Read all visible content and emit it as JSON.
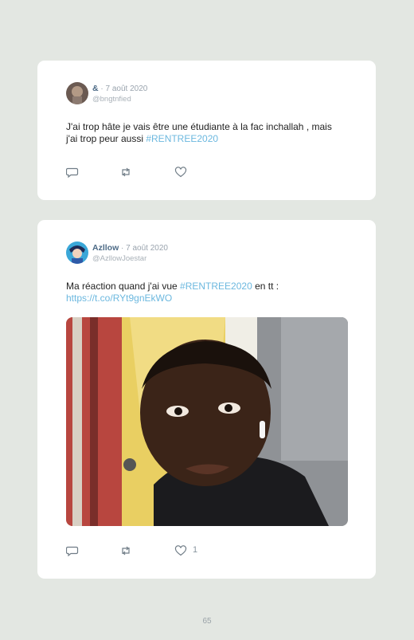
{
  "tweets": [
    {
      "name": "&",
      "date": "7 août 2020",
      "handle": "@bngtnfied",
      "text": "J'ai trop hâte je vais être une étudiante à la fac inchallah , mais j'ai trop peur aussi ",
      "hashtag": "#RENTREE2020",
      "actions": {
        "reply": "reply-icon",
        "retweet": "retweet-icon",
        "like": "heart-icon"
      }
    },
    {
      "name": "Azllow",
      "date": "7 août 2020",
      "handle": "@AzllowJoestar",
      "text_before": "Ma réaction quand j'ai vue ",
      "hashtag": "#RENTREE2020",
      "text_after": " en tt :",
      "link": "https://t.co/RYt9gnEkWO",
      "like_count": "1",
      "actions": {
        "reply": "reply-icon",
        "retweet": "retweet-icon",
        "like": "heart-icon"
      }
    }
  ],
  "page": {
    "number": "65"
  },
  "colors": {
    "background": "#e3e7e2",
    "card": "#ffffff",
    "accent": "#6cb8df",
    "name": "#4c6a86"
  }
}
